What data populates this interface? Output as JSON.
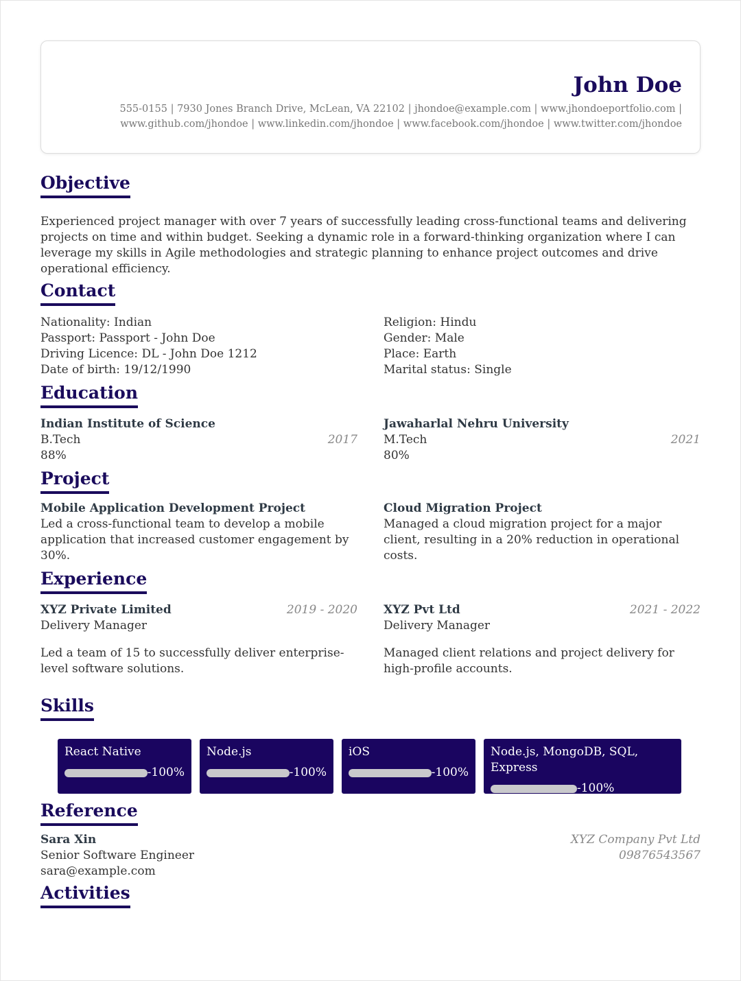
{
  "header": {
    "name": "John Doe",
    "contact_line1": "555-0155 | 7930 Jones Branch Drive, McLean, VA 22102 | jhondoe@example.com | www.jhondoeportfolio.com |",
    "contact_line2": "www.github.com/jhondoe | www.linkedin.com/jhondoe | www.facebook.com/jhondoe | www.twitter.com/jhondoe"
  },
  "objective": {
    "title": "Objective",
    "text": "Experienced project manager with over 7 years of successfully leading cross-functional teams and delivering projects on time and within budget. Seeking a dynamic role in a forward-thinking organization where I can leverage my skills in Agile methodologies and strategic planning to enhance project outcomes and drive operational efficiency."
  },
  "contact": {
    "title": "Contact",
    "left": [
      "Nationality: Indian",
      "Passport: Passport - John Doe",
      "Driving Licence: DL - John Doe 1212",
      "Date of birth: 19/12/1990"
    ],
    "right": [
      "Religion: Hindu",
      "Gender: Male",
      "Place: Earth",
      "Marital status: Single"
    ]
  },
  "education": {
    "title": "Education",
    "items": [
      {
        "school": "Indian Institute of Science",
        "degree": "B.Tech",
        "year": "2017",
        "score": "88%"
      },
      {
        "school": "Jawaharlal Nehru University",
        "degree": "M.Tech",
        "year": "2021",
        "score": "80%"
      }
    ]
  },
  "project": {
    "title": "Project",
    "items": [
      {
        "name": "Mobile Application Development Project",
        "desc": "Led a cross-functional team to develop a mobile application that increased customer engagement by 30%."
      },
      {
        "name": "Cloud Migration Project",
        "desc": "Managed a cloud migration project for a major client, resulting in a 20% reduction in operational costs."
      }
    ]
  },
  "experience": {
    "title": "Experience",
    "items": [
      {
        "company": "XYZ Private Limited",
        "period": "2019 - 2020",
        "role": "Delivery Manager",
        "desc": "Led a team of 15 to successfully deliver enterprise-level software solutions."
      },
      {
        "company": "XYZ Pvt Ltd",
        "period": "2021 - 2022",
        "role": "Delivery Manager",
        "desc": "Managed client relations and project delivery for high-profile accounts."
      }
    ]
  },
  "skills": {
    "title": "Skills",
    "items": [
      {
        "name": "React Native",
        "label": "-100%",
        "level": 100
      },
      {
        "name": "Node.js",
        "label": "-100%",
        "level": 100
      },
      {
        "name": "iOS",
        "label": "-100%",
        "level": 100
      },
      {
        "name": "Node.js, MongoDB, SQL, Express",
        "label": "-100%",
        "level": 100
      }
    ]
  },
  "reference": {
    "title": "Reference",
    "name": "Sara Xin",
    "role": "Senior Software Engineer",
    "email": "sara@example.com",
    "company": "XYZ Company Pvt Ltd",
    "phone": "09876543567"
  },
  "activities": {
    "title": "Activities"
  },
  "colors": {
    "accent": "#1a0b5c",
    "skill_card": "#1a0560",
    "bar": "#c9c9cc"
  }
}
